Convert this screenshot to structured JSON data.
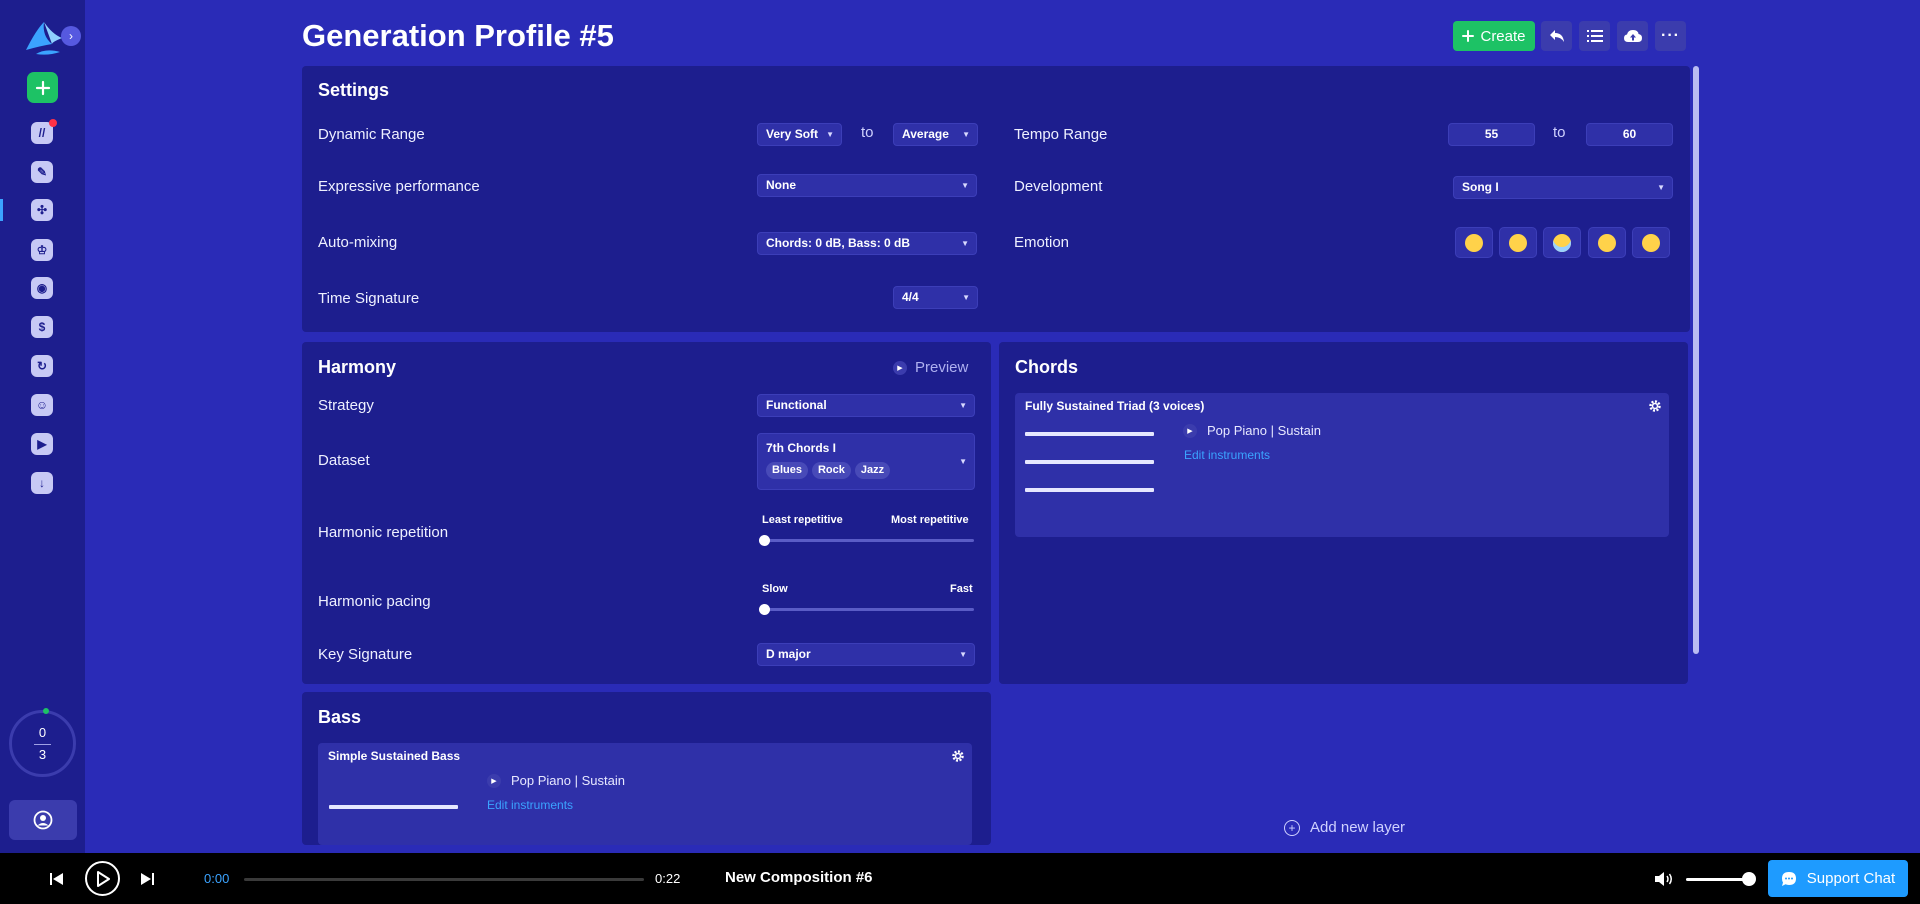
{
  "page": {
    "title": "Generation Profile #5"
  },
  "header": {
    "create_label": "Create"
  },
  "sidebar": {
    "credits_used": "0",
    "credits_total": "3",
    "icons": [
      "ai-music-icon",
      "pen-icon",
      "generation-profile-icon",
      "medal-icon",
      "broadcast-icon",
      "dollar-icon",
      "history-icon",
      "discord-icon",
      "play-icon",
      "download-icon"
    ]
  },
  "settings": {
    "title": "Settings",
    "dynamic_range": {
      "label": "Dynamic Range",
      "from": "Very Soft",
      "to_word": "to",
      "to": "Average"
    },
    "tempo_range": {
      "label": "Tempo Range",
      "from": "55",
      "to_word": "to",
      "to": "60"
    },
    "expressive": {
      "label": "Expressive performance",
      "value": "None"
    },
    "development": {
      "label": "Development",
      "value": "Song I"
    },
    "auto_mixing": {
      "label": "Auto-mixing",
      "value": "Chords: 0 dB, Bass: 0 dB"
    },
    "emotion": {
      "label": "Emotion",
      "options": [
        "relieved-face",
        "partying-face",
        "anxious-face",
        "crying-face",
        "grimacing-face"
      ]
    },
    "time_signature": {
      "label": "Time Signature",
      "value": "4/4"
    }
  },
  "harmony": {
    "title": "Harmony",
    "preview_label": "Preview",
    "strategy": {
      "label": "Strategy",
      "value": "Functional"
    },
    "dataset": {
      "label": "Dataset",
      "value": "7th Chords I",
      "tags": [
        "Blues",
        "Rock",
        "Jazz"
      ]
    },
    "repetition": {
      "label": "Harmonic repetition",
      "min_label": "Least repetitive",
      "max_label": "Most repetitive",
      "value": 0
    },
    "pacing": {
      "label": "Harmonic pacing",
      "min_label": "Slow",
      "max_label": "Fast",
      "value": 0
    },
    "key_signature": {
      "label": "Key Signature",
      "value": "D major"
    }
  },
  "chords": {
    "title": "Chords",
    "layer": {
      "name": "Fully Sustained Triad (3 voices)",
      "instrument": "Pop Piano | Sustain",
      "edit_label": "Edit instruments"
    }
  },
  "bass": {
    "title": "Bass",
    "layer": {
      "name": "Simple Sustained Bass",
      "instrument": "Pop Piano | Sustain",
      "edit_label": "Edit instruments"
    }
  },
  "add_layer_label": "Add new layer",
  "player": {
    "current_time": "0:00",
    "duration": "0:22",
    "track_title": "New Composition #6",
    "progress": 0,
    "volume": 0.9,
    "support_label": "Support Chat"
  },
  "colors": {
    "background": "#2a2bb7",
    "panel": "#1d1e8e",
    "accent_green": "#1dc265",
    "accent_blue": "#1e9bff"
  }
}
